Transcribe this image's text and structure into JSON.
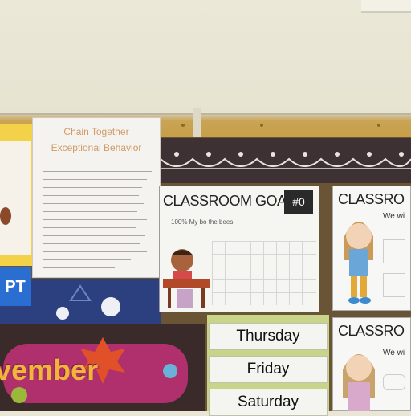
{
  "left_poster": {
    "label": "PT"
  },
  "chain_poster": {
    "title_line1": "Chain Together",
    "title_line2": "Exceptional Behavior"
  },
  "goal_poster": {
    "title": "CLASSROOM GOAL",
    "badge": "#0",
    "subtitle": "100% My bo the bees"
  },
  "right_posters": [
    {
      "title": "CLASSRO",
      "text": "We wi"
    },
    {
      "title": "CLASSRO",
      "text": "We wi"
    }
  ],
  "days": [
    "Thursday",
    "Friday",
    "Saturday"
  ],
  "month_banner": {
    "text": "vember"
  },
  "colors": {
    "rail": "#c79e47",
    "cork": "#6a5436",
    "days_bg": "#c8d48a",
    "month_text": "#f0b638"
  }
}
